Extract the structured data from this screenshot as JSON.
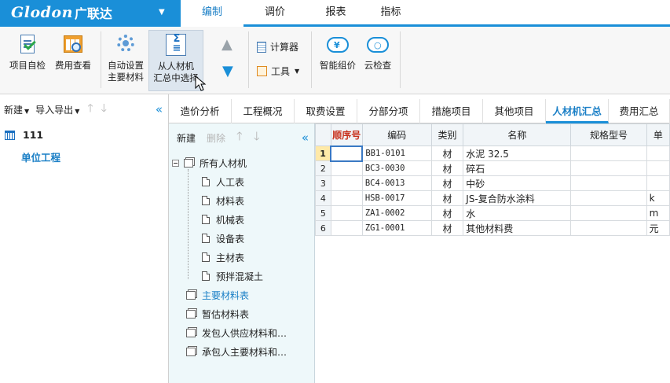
{
  "app": {
    "brand": "Glodon",
    "brand_cn": "广联达"
  },
  "menus": [
    "编制",
    "调价",
    "报表",
    "指标"
  ],
  "active_menu": "编制",
  "ribbon": {
    "project_check": "项目自检",
    "fee_view": "费用查看",
    "auto_main_1": "自动设置",
    "auto_main_2": "主要材料",
    "select_1": "从人材机",
    "select_2": "汇总中选择",
    "calculator": "计算器",
    "tools": "工具",
    "smart_price": "智能组价",
    "cloud_check": "云检查"
  },
  "left": {
    "new": "新建",
    "import_export": "导入导出",
    "project_name": "111",
    "unit_project": "单位工程"
  },
  "tabs": [
    "造价分析",
    "工程概况",
    "取费设置",
    "分部分项",
    "措施项目",
    "其他项目",
    "人材机汇总",
    "费用汇总"
  ],
  "active_tab": "人材机汇总",
  "mid": {
    "new": "新建",
    "delete": "删除",
    "root": "所有人材机",
    "children": [
      "人工表",
      "材料表",
      "机械表",
      "设备表",
      "主材表",
      "预拌混凝土"
    ],
    "others": [
      "主要材料表",
      "暂估材料表",
      "发包人供应材料和…",
      "承包人主要材料和…"
    ],
    "selected": "主要材料表"
  },
  "grid": {
    "headers": [
      "",
      "顺序号",
      "编码",
      "类别",
      "名称",
      "规格型号",
      "单"
    ],
    "rows": [
      {
        "no": "1",
        "seq": "",
        "code": "BB1-0101",
        "cat": "材",
        "name": "水泥 32.5",
        "spec": "",
        "unit": ""
      },
      {
        "no": "2",
        "seq": "",
        "code": "BC3-0030",
        "cat": "材",
        "name": "碎石",
        "spec": "",
        "unit": ""
      },
      {
        "no": "3",
        "seq": "",
        "code": "BC4-0013",
        "cat": "材",
        "name": "中砂",
        "spec": "",
        "unit": ""
      },
      {
        "no": "4",
        "seq": "",
        "code": "HSB-0017",
        "cat": "材",
        "name": "JS-复合防水涂料",
        "spec": "",
        "unit": "k"
      },
      {
        "no": "5",
        "seq": "",
        "code": "ZA1-0002",
        "cat": "材",
        "name": "水",
        "spec": "",
        "unit": "m"
      },
      {
        "no": "6",
        "seq": "",
        "code": "ZG1-0001",
        "cat": "材",
        "name": "其他材料费",
        "spec": "",
        "unit": "元"
      }
    ]
  },
  "colors": {
    "accent": "#1a8fd8",
    "active_text": "#1a7fc6",
    "seq_header": "#c8321e"
  }
}
